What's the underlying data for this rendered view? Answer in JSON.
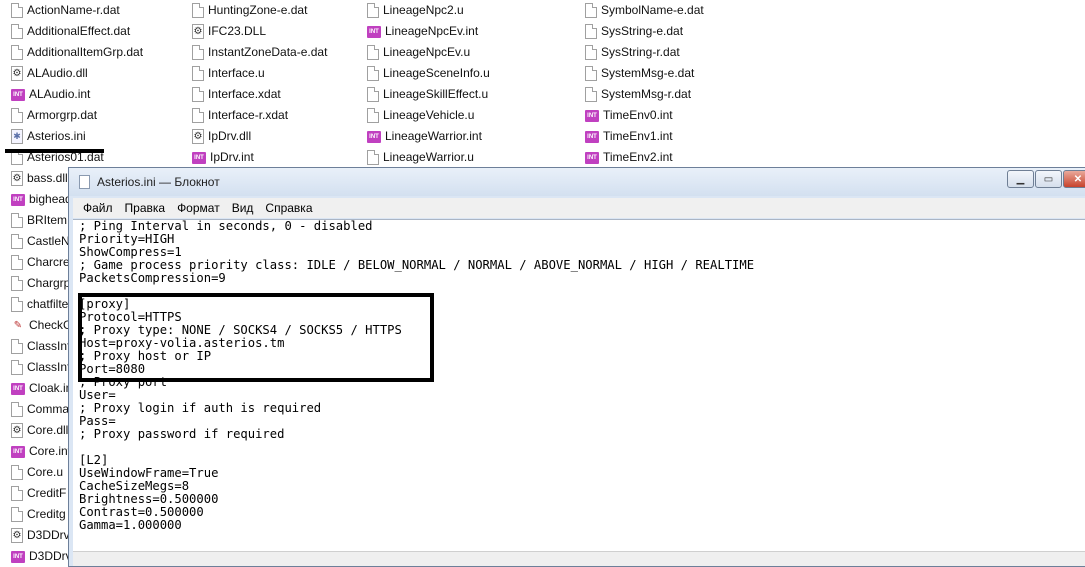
{
  "explorer": {
    "columns": [
      [
        {
          "name": "ActionName-r.dat",
          "icon": "doc"
        },
        {
          "name": "AdditionalEffect.dat",
          "icon": "doc"
        },
        {
          "name": "AdditionalItemGrp.dat",
          "icon": "doc"
        },
        {
          "name": "ALAudio.dll",
          "icon": "dll"
        },
        {
          "name": "ALAudio.int",
          "icon": "int"
        },
        {
          "name": "Armorgrp.dat",
          "icon": "doc"
        },
        {
          "name": "Asterios.ini",
          "icon": "ini"
        },
        {
          "name": "Asterios01.dat",
          "icon": "doc"
        },
        {
          "name": "bass.dll",
          "icon": "dll"
        },
        {
          "name": "bighead",
          "icon": "int"
        },
        {
          "name": "BRItem",
          "icon": "doc"
        },
        {
          "name": "CastleN",
          "icon": "doc"
        },
        {
          "name": "Charcre",
          "icon": "doc"
        },
        {
          "name": "Chargrp",
          "icon": "doc"
        },
        {
          "name": "chatfilte",
          "icon": "doc"
        },
        {
          "name": "CheckG",
          "icon": "chk"
        },
        {
          "name": "ClassInf",
          "icon": "doc"
        },
        {
          "name": "ClassInf",
          "icon": "doc"
        },
        {
          "name": "Cloak.in",
          "icon": "int"
        },
        {
          "name": "Comma",
          "icon": "doc"
        },
        {
          "name": "Core.dll",
          "icon": "dll"
        },
        {
          "name": "Core.int",
          "icon": "int"
        },
        {
          "name": "Core.u",
          "icon": "doc"
        },
        {
          "name": "CreditF",
          "icon": "doc"
        },
        {
          "name": "Creditg",
          "icon": "doc"
        },
        {
          "name": "D3DDrv",
          "icon": "dll"
        },
        {
          "name": "D3DDrv",
          "icon": "int"
        }
      ],
      [
        {
          "name": "HuntingZone-e.dat",
          "icon": "doc"
        },
        {
          "name": "IFC23.DLL",
          "icon": "dll"
        },
        {
          "name": "InstantZoneData-e.dat",
          "icon": "doc"
        },
        {
          "name": "Interface.u",
          "icon": "doc"
        },
        {
          "name": "Interface.xdat",
          "icon": "doc"
        },
        {
          "name": "Interface-r.xdat",
          "icon": "doc"
        },
        {
          "name": "IpDrv.dll",
          "icon": "dll"
        },
        {
          "name": "IpDrv.int",
          "icon": "int"
        }
      ],
      [
        {
          "name": "LineageNpc2.u",
          "icon": "doc"
        },
        {
          "name": "LineageNpcEv.int",
          "icon": "int"
        },
        {
          "name": "LineageNpcEv.u",
          "icon": "doc"
        },
        {
          "name": "LineageSceneInfo.u",
          "icon": "doc"
        },
        {
          "name": "LineageSkillEffect.u",
          "icon": "doc"
        },
        {
          "name": "LineageVehicle.u",
          "icon": "doc"
        },
        {
          "name": "LineageWarrior.int",
          "icon": "int"
        },
        {
          "name": "LineageWarrior.u",
          "icon": "doc"
        }
      ],
      [
        {
          "name": "SymbolName-e.dat",
          "icon": "doc"
        },
        {
          "name": "SysString-e.dat",
          "icon": "doc"
        },
        {
          "name": "SysString-r.dat",
          "icon": "doc"
        },
        {
          "name": "SystemMsg-e.dat",
          "icon": "doc"
        },
        {
          "name": "SystemMsg-r.dat",
          "icon": "doc"
        },
        {
          "name": "TimeEnv0.int",
          "icon": "int"
        },
        {
          "name": "TimeEnv1.int",
          "icon": "int"
        },
        {
          "name": "TimeEnv2.int",
          "icon": "int"
        }
      ]
    ]
  },
  "notepad": {
    "title": "Asterios.ini — Блокнот",
    "menu": [
      "Файл",
      "Правка",
      "Формат",
      "Вид",
      "Справка"
    ],
    "lines": [
      "; Ping Interval in seconds, 0 - disabled",
      "Priority=HIGH",
      "ShowCompress=1",
      "; Game process priority class: IDLE / BELOW_NORMAL / NORMAL / ABOVE_NORMAL / HIGH / REALTIME",
      "PacketsCompression=9",
      "",
      "[proxy]",
      "Protocol=HTTPS",
      "; Proxy type: NONE / SOCKS4 / SOCKS5 / HTTPS",
      "Host=proxy-volia.asterios.tm",
      "; Proxy host or IP",
      "Port=8080",
      "; Proxy port",
      "User=",
      "; Proxy login if auth is required",
      "Pass=",
      "; Proxy password if required",
      "",
      "[L2]",
      "UseWindowFrame=True",
      "CacheSizeMegs=8",
      "Brightness=0.500000",
      "Contrast=0.500000",
      "Gamma=1.000000"
    ]
  }
}
